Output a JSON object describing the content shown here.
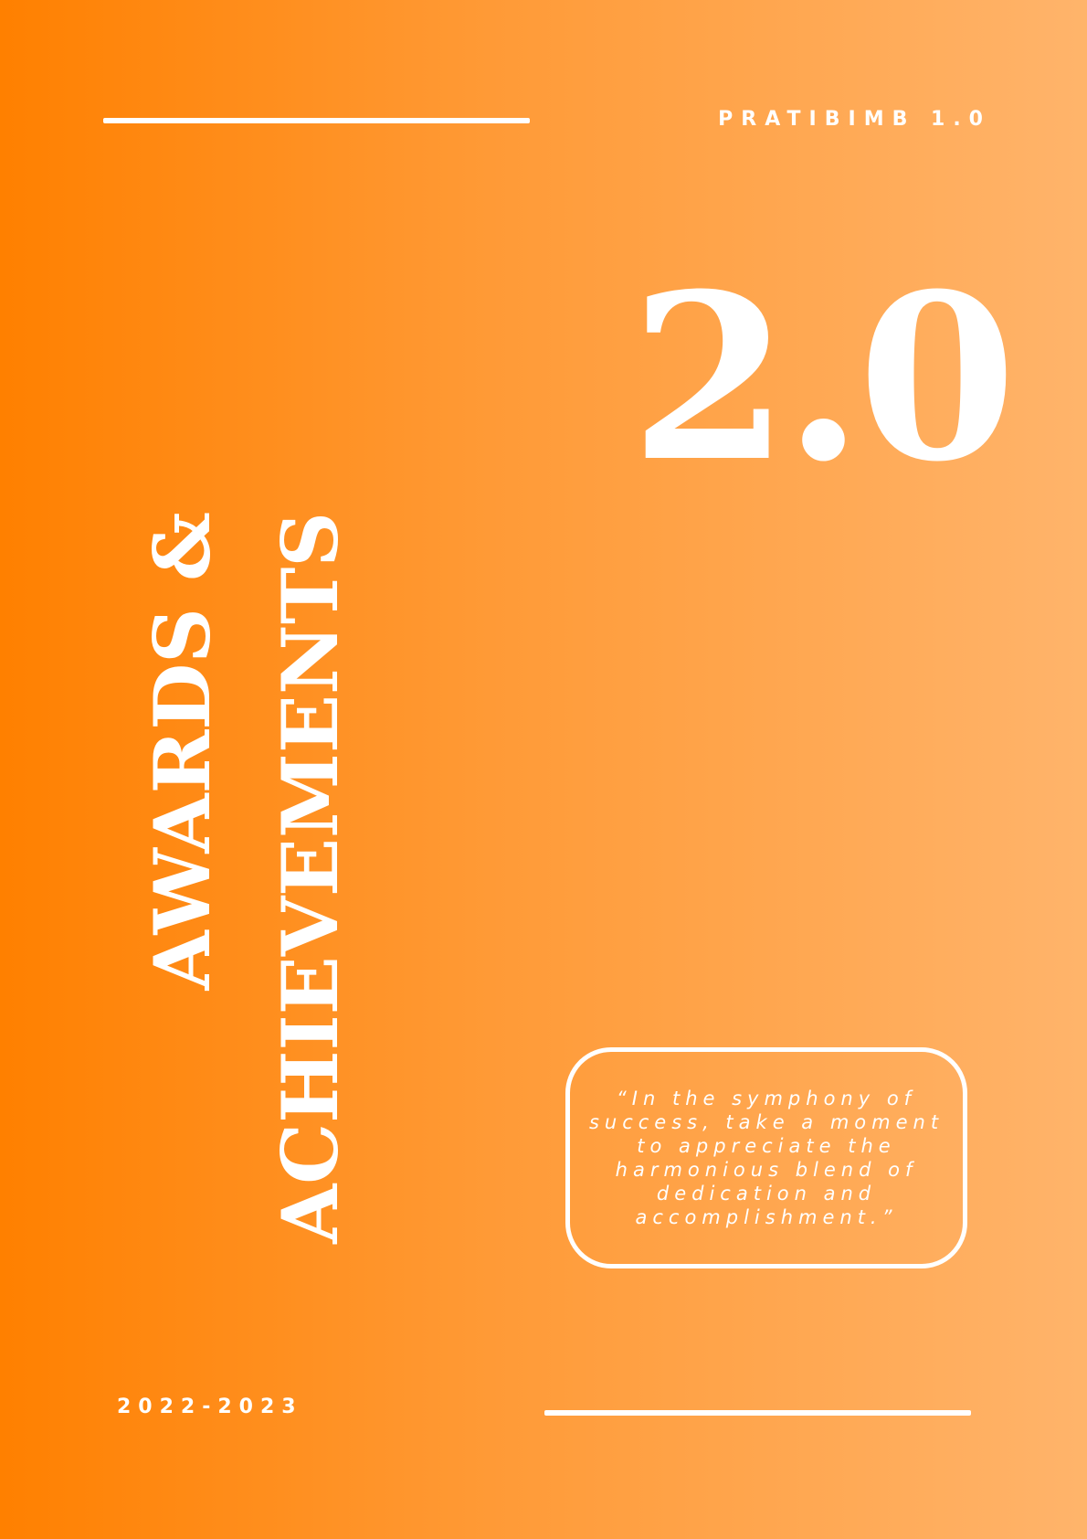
{
  "cover": {
    "series_label": "PRATIBIMB 1.0",
    "edition_number": "2.0",
    "title_line1": "AWARDS &",
    "title_line2": "ACHIEVEMENTS",
    "quote": "“In the symphony of success, take a moment to appreciate the harmonious blend of dedication and accomplishment.”",
    "year_range": "2022-2023"
  },
  "colors": {
    "gradient_start": "#ff8000",
    "gradient_end": "#ffb46b",
    "text": "#ffffff"
  }
}
